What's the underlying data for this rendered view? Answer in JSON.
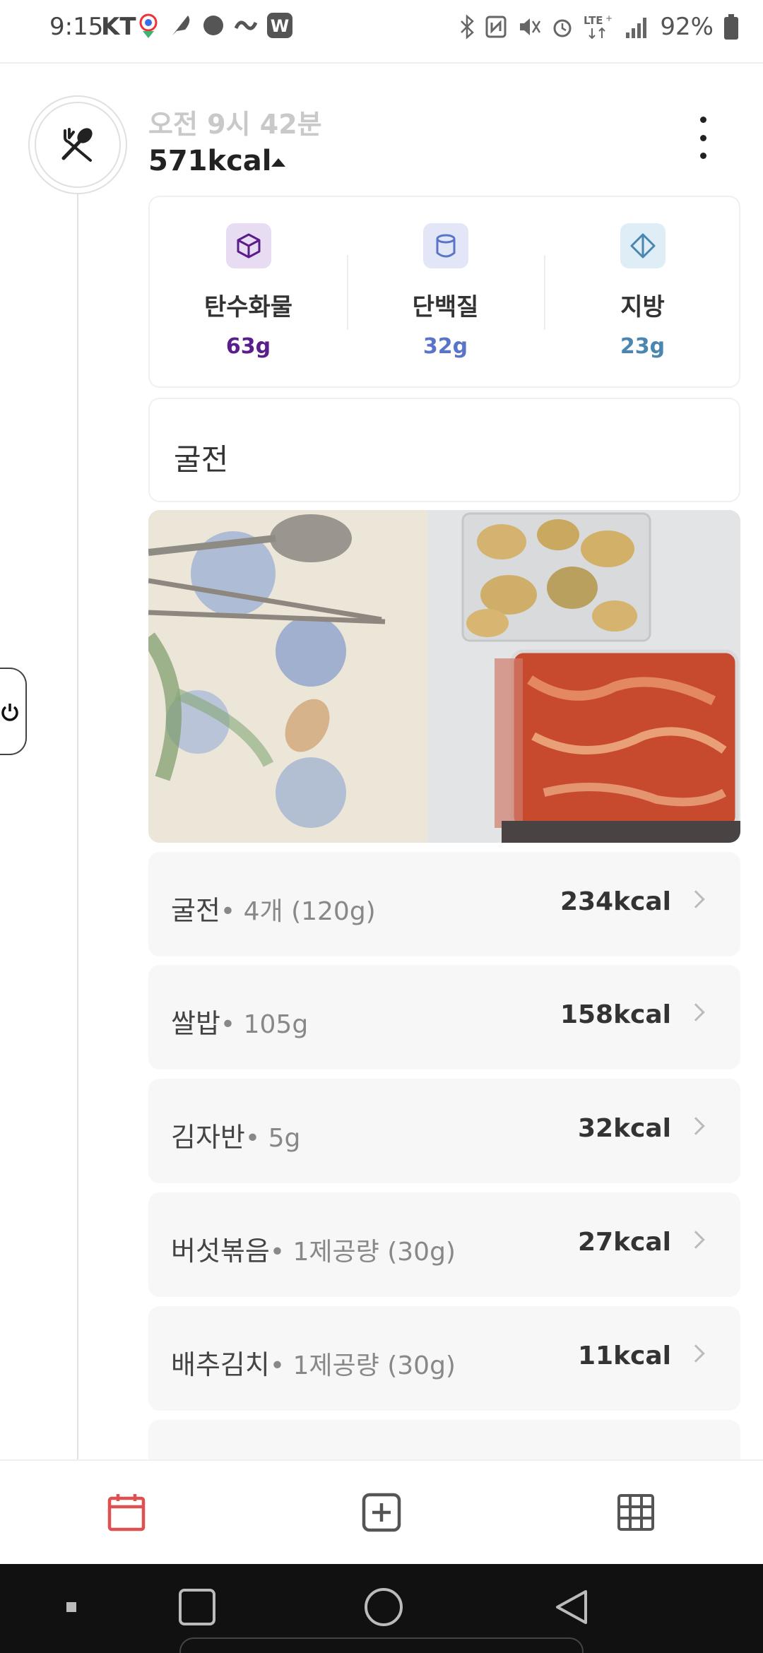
{
  "status_bar": {
    "time": "9:15",
    "carrier": "KT",
    "battery": "92%",
    "network": "LTE+"
  },
  "meal": {
    "time": "오전 9시 42분",
    "kcal": "571kcal",
    "title": "굴전"
  },
  "macros": [
    {
      "label": "탄수화물",
      "value": "63g",
      "color": "#5a1e8c"
    },
    {
      "label": "단백질",
      "value": "32g",
      "color": "#5a74c8"
    },
    {
      "label": "지방",
      "value": "23g",
      "color": "#4a86b0"
    }
  ],
  "foods": [
    {
      "name": "굴전",
      "portion": "• 4개 (120g)",
      "kcal": "234kcal"
    },
    {
      "name": "쌀밥",
      "portion": "• 105g",
      "kcal": "158kcal"
    },
    {
      "name": "김자반",
      "portion": "• 5g",
      "kcal": "32kcal"
    },
    {
      "name": "버섯볶음",
      "portion": "• 1제공량 (30g)",
      "kcal": "27kcal"
    },
    {
      "name": "배추김치",
      "portion": "• 1제공량 (30g)",
      "kcal": "11kcal"
    }
  ],
  "bottom_nav": {
    "items": [
      "calendar-icon",
      "add-square-icon",
      "grid-icon"
    ],
    "active_color": "#e05050"
  }
}
